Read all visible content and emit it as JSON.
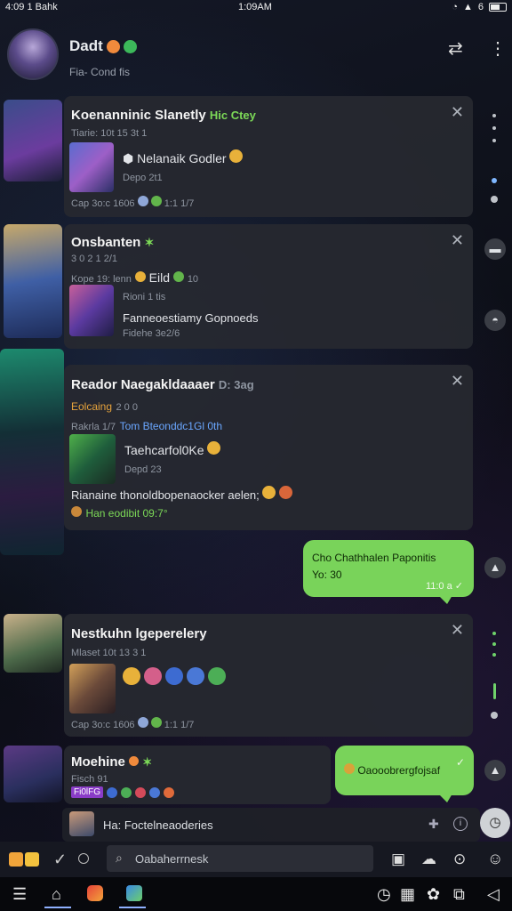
{
  "status": {
    "left_text": "4:09 1 Bahk",
    "time": "1:09AM",
    "right_text": "6"
  },
  "header": {
    "title": "Dadt",
    "subtitle": "Fia- Cond fis"
  },
  "cards": [
    {
      "title": "Koenanninic Slanetly",
      "title_suffix": "Hic Ctey",
      "line1": "Tiarie: 10t  15 3t 1",
      "line2": "Nelanaik Godler",
      "line3": "Depo 2t1",
      "line4": "Cap 3o:c  1606",
      "line4b": "1:1 1/7"
    },
    {
      "title": "Onsbanten",
      "line1": "3 0 2 1 2/1",
      "line2": "Kope 19:  lenn",
      "line2b": "Eild",
      "line2c": "10",
      "line3": "Rioni 1 tis",
      "line4": "Fanneoestiamy Gopnoeds",
      "line5": "Fidehe 3e2/6"
    },
    {
      "title": "Reador Naegakldaaaer",
      "title_suffix": "D: 3ag",
      "line1": "Eolcaing",
      "line1b": "2 0 0",
      "line2": "Rakrla 1/7",
      "line2b": "Tom Bteonddc1Gl 0th",
      "line3": "Taehcarfol0Ke",
      "line4": "Depd 23",
      "line5": "Rianaine thonoldbopenaocker aelen;",
      "line6": "Han eodibit 09:7°"
    },
    {
      "title": "Nestkuhn lgeperelery",
      "line1": "Mlaset 10t  13 3 1",
      "line2": "Cap 3o:c  1606",
      "line2b": "1:1 1/7"
    },
    {
      "title": "Moehine",
      "line1": "Fisch 91",
      "line2": "Fi0lFG"
    }
  ],
  "bubbles": [
    {
      "line1": "Cho Chathhalen Paponitis",
      "line2": "Yo: 30",
      "meta": "11:0 a"
    },
    {
      "text": "Oaooobrergfojsaf"
    }
  ],
  "reply_bar": {
    "text": "Ha: Foctelneaoderies"
  },
  "input": {
    "placeholder": "Oabaherrnesk"
  },
  "colors": {
    "accent": "#79d35a",
    "card": "#26282f"
  }
}
